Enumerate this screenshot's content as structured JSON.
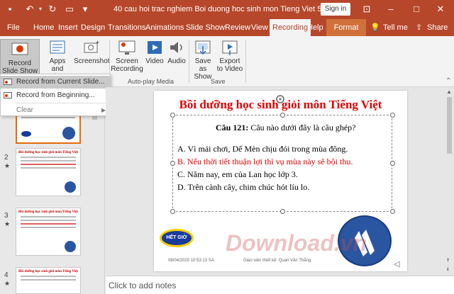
{
  "titlebar": {
    "title": "40 cau hoi trac nghiem Boi duong hoc sinh mon Tieng Viet 5  P4.p...",
    "sign_in": "Sign in",
    "color": "#b7472a"
  },
  "tabs": [
    {
      "label": "File"
    },
    {
      "label": "Home"
    },
    {
      "label": "Insert"
    },
    {
      "label": "Design"
    },
    {
      "label": "Transitions"
    },
    {
      "label": "Animations"
    },
    {
      "label": "Slide Show"
    },
    {
      "label": "Review"
    },
    {
      "label": "View"
    },
    {
      "label": "Recording"
    },
    {
      "label": "Help"
    },
    {
      "label": "Format"
    },
    {
      "label": "Tell me"
    },
    {
      "label": "Share"
    }
  ],
  "ribbon": {
    "record_slide_show": "Record Slide Show",
    "apps_quizzes": "Apps and Quizzes",
    "screenshot": "Screenshot",
    "screen_recording": "Screen Recording",
    "video": "Video",
    "audio": "Audio",
    "save_as_show": "Save as Show",
    "export_to_video": "Export to Video",
    "group_autoplay": "Auto-play Media",
    "group_save": "Save"
  },
  "menu": {
    "item1": "Record from Current Slide...",
    "item2": "Record from Beginning...",
    "item3": "Clear"
  },
  "slides": {
    "n2": "2",
    "n3": "3",
    "n4": "4"
  },
  "slide": {
    "title": "Bồi dưỡng học sinh giỏi môn Tiếng Việt",
    "q_label": "Câu 121:",
    "q_text": " Câu nào dưới đây là câu ghép?",
    "a": "A. Vì mải chơi, Dế Mèn chịu đói trong mùa đông.",
    "b": "B. Nếu thời tiết thuận lợi thì vụ mùa này sẽ bội thu.",
    "c": "C. Năm nay, em của Lan học lớp 3.",
    "d": "D. Trên cành cây, chim chúc hót líu lo.",
    "badge": "HẾT GIỜ",
    "date": "06/04/2020 10:53:13 SA",
    "author": "Giáo viên thiết kế: Quan Văn Thắng"
  },
  "notes_placeholder": "Click to add notes",
  "watermark": "Download.vn"
}
